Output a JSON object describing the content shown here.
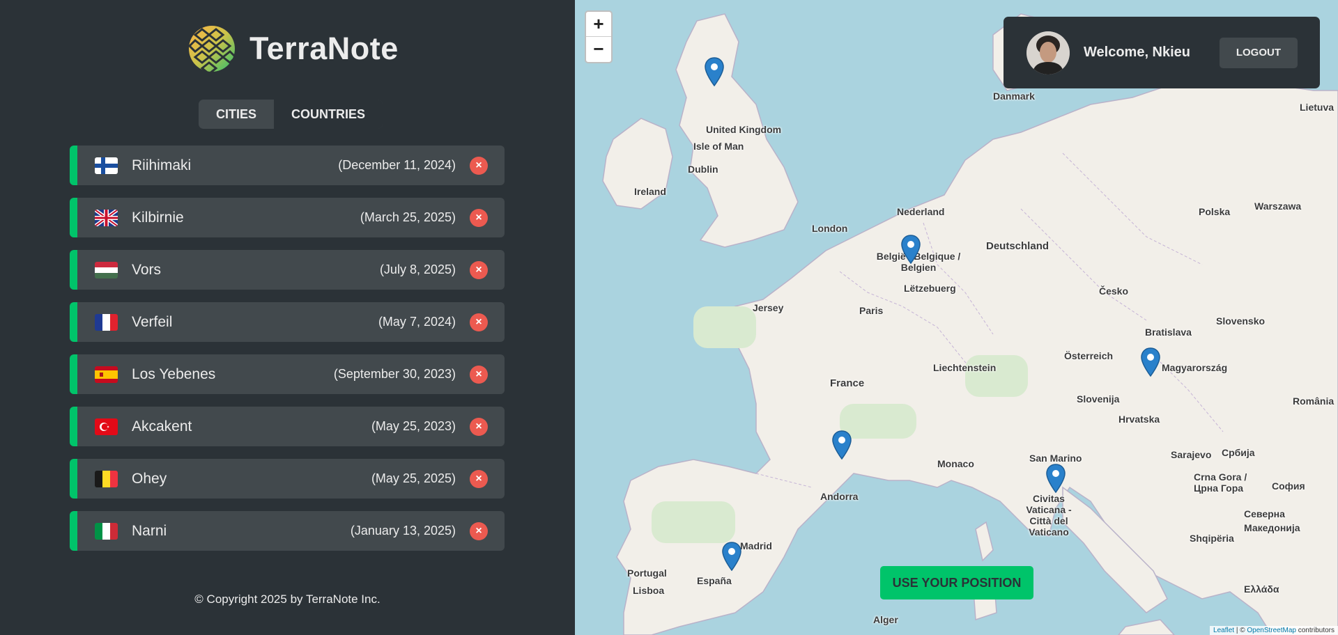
{
  "app": {
    "name": "TerraNote"
  },
  "tabs": [
    {
      "label": "Cities",
      "active": false
    },
    {
      "label": "Countries",
      "active": true
    }
  ],
  "cities": [
    {
      "flag": "fi",
      "name": "Riihimaki",
      "date": "(December 11, 2024)"
    },
    {
      "flag": "gb",
      "name": "Kilbirnie",
      "date": "(March 25, 2025)"
    },
    {
      "flag": "hu",
      "name": "Vors",
      "date": "(July 8, 2025)"
    },
    {
      "flag": "fr",
      "name": "Verfeil",
      "date": "(May 7, 2024)"
    },
    {
      "flag": "es",
      "name": "Los Yebenes",
      "date": "(September 30, 2023)"
    },
    {
      "flag": "tr",
      "name": "Akcakent",
      "date": "(May 25, 2023)"
    },
    {
      "flag": "be",
      "name": "Ohey",
      "date": "(May 25, 2025)"
    },
    {
      "flag": "it",
      "name": "Narni",
      "date": "(January 13, 2025)"
    }
  ],
  "delete_symbol": "×",
  "footer": {
    "copyright": "© Copyright 2025 by TerraNote Inc."
  },
  "map": {
    "zoom_in": "+",
    "zoom_out": "−",
    "places": [
      "United Kingdom",
      "Isle of Man",
      "Dublin",
      "Ireland",
      "London",
      "Nederland",
      "België / Belgique / Belgien",
      "Lëtzebuerg",
      "Deutschland",
      "Danmark",
      "Polska",
      "Warszawa",
      "Lietuva",
      "Jersey",
      "Paris",
      "France",
      "Česko",
      "Bratislava",
      "Slovensko",
      "Österreich",
      "Liechtenstein",
      "Magyarország",
      "Slovenija",
      "Hrvatska",
      "România",
      "Monaco",
      "San Marino",
      "Andorra",
      "Civitas Vaticana - Città del Vaticano",
      "Sarajevo",
      "Crna Gora / Црна Гора",
      "Србија",
      "София",
      "Shqipëria",
      "Македонија",
      "Ελλάδα",
      "Portugal",
      "Lisboa",
      "España",
      "Madrid",
      "Alger",
      "Северна"
    ],
    "use_position_label": "Use your position",
    "attribution": {
      "leaflet": "Leaflet",
      "osm": "OpenStreetMap",
      "suffix": "contributors"
    }
  },
  "user": {
    "welcome": "Welcome, Nkieu",
    "logout_label": "Logout"
  },
  "colors": {
    "accent": "#00c46a",
    "delete": "#ec5a50",
    "panel": "#2b3237",
    "item": "#42494d",
    "marker": "#2a81cb"
  }
}
